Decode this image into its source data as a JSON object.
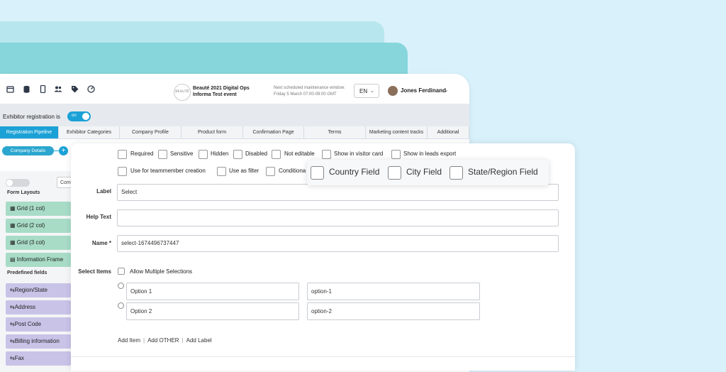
{
  "header": {
    "logo_text": "BEAUTÉ",
    "event_title": "Beauté 2021 Digital Ops",
    "event_subtitle": "Informa Test event",
    "maintenance_title": "Next scheduled maintenance window:",
    "maintenance_time": "Friday 5 March 07:00-09:00 GMT",
    "language": "EN",
    "user_name": "Jones Ferdinand",
    "icons": [
      "calendar-icon",
      "database-icon",
      "mobile-icon",
      "users-icon",
      "tag-icon",
      "gauge-icon"
    ]
  },
  "registration": {
    "label": "Exhibitor registration is",
    "toggle_label": "on"
  },
  "tabs": [
    "Registration Pipeline",
    "Exhibitor Categories",
    "Company Profile",
    "Product form",
    "Confirmation Page",
    "Terms",
    "Marketing content tracks",
    "Additional"
  ],
  "sidebar": {
    "step_label": "Company Details",
    "combo_text": "Com",
    "form_layouts_heading": "Form Layouts",
    "layouts": [
      "Grid (1 col)",
      "Grid (2 col)",
      "Grid (3 col)",
      "Information Frame"
    ],
    "predefined_heading": "Predefined fields",
    "predefined": [
      "Region/State",
      "Address",
      "Post Code",
      "Billing information",
      "Fax"
    ]
  },
  "options": {
    "row1": [
      "Required",
      "Sensitive",
      "Hidden",
      "Disabled",
      "Not editable",
      "Show in visitor card",
      "Show in leads export"
    ],
    "row2": [
      "Use for teammember creation",
      "Use as filter",
      "Conditiona"
    ]
  },
  "form": {
    "label_label": "Label",
    "label_value": "Select",
    "help_label": "Help Text",
    "help_value": "",
    "name_label": "Name *",
    "name_value": "select-1674496737447",
    "select_items_label": "Select Items",
    "allow_multiple": "Allow Multiple Selections",
    "items": [
      {
        "label": "Option 1",
        "value": "option-1"
      },
      {
        "label": "Option 2",
        "value": "option-2"
      }
    ],
    "add_item": "Add Item",
    "add_other": "Add OTHER",
    "add_label": "Add Label"
  },
  "popup": {
    "fields": [
      "Country Field",
      "City Field",
      "State/Region Field"
    ]
  }
}
